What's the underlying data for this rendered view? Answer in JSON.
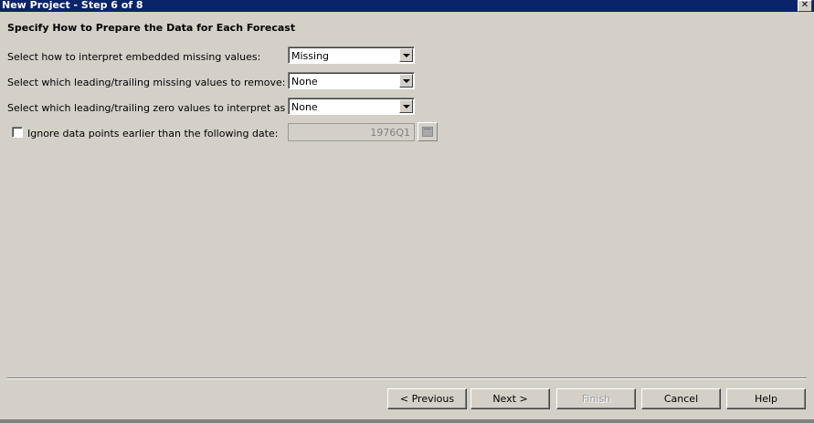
{
  "window": {
    "title": "New Project - Step 6 of 8",
    "close_label": "✕"
  },
  "heading": "Specify How to Prepare the Data for Each Forecast",
  "rows": [
    {
      "label": "Select how to interpret embedded missing values:",
      "value": "Missing"
    },
    {
      "label": "Select which leading/trailing missing values to remove:",
      "value": "None"
    },
    {
      "label": "Select which leading/trailing zero values to interpret as missing:",
      "value": "None"
    }
  ],
  "ignore_option": {
    "label": "Ignore data points earlier than the following date:",
    "checked": false,
    "date_value": "1976Q1"
  },
  "buttons": {
    "previous": "< Previous",
    "next": "Next >",
    "finish": "Finish",
    "cancel": "Cancel",
    "help": "Help"
  },
  "colors": {
    "titlebar": "#0a246a",
    "dialog": "#d4d0c8"
  }
}
